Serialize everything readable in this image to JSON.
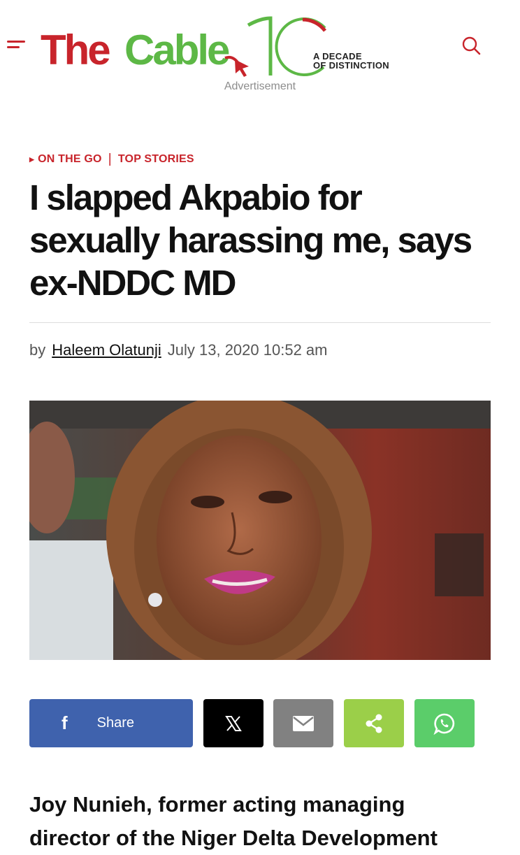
{
  "header": {
    "menu_icon": "hamburger-menu-icon",
    "logo_the": "The",
    "logo_cable": "Cable",
    "logo_tagline_line1": "A DECADE",
    "logo_tagline_line2": "OF DISTINCTION",
    "advertisement_label": "Advertisement",
    "search_icon": "search-icon",
    "colors": {
      "brand_red": "#c8242b",
      "brand_green": "#5db846"
    }
  },
  "article": {
    "categories": [
      "ON THE GO",
      "TOP STORIES"
    ],
    "title": "I slapped Akpabio for sexually harassing me, says ex-NDDC MD",
    "byline_prefix": "by",
    "author": "Haleem Olatunji",
    "date": "July 13, 2020 10:52 am",
    "lead": "Joy Nunieh, former acting managing director of the Niger Delta Development"
  },
  "share": {
    "facebook_label": "Share",
    "facebook_icon": "facebook-icon",
    "x_icon": "x-icon",
    "email_icon": "email-icon",
    "share_icon": "share-icon",
    "whatsapp_icon": "whatsapp-icon",
    "colors": {
      "facebook": "#3f62ad",
      "x": "#000000",
      "email": "#818181",
      "share": "#9bcf49",
      "whatsapp": "#5bcd6a"
    }
  }
}
